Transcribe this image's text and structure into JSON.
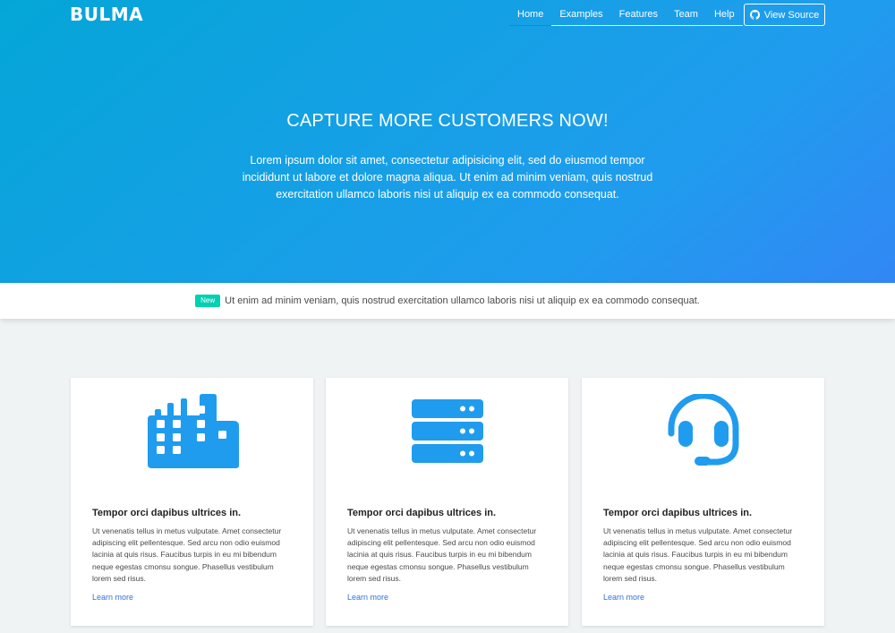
{
  "brand": "BULMA",
  "nav": {
    "items": [
      "Home",
      "Examples",
      "Features",
      "Team",
      "Help"
    ],
    "view_source": "View Source"
  },
  "hero": {
    "title": "CAPTURE MORE CUSTOMERS NOW!",
    "subtitle": "Lorem ipsum dolor sit amet, consectetur adipisicing elit, sed do eiusmod tempor incididunt ut labore et dolore magna aliqua. Ut enim ad minim veniam, quis nostrud exercitation ullamco laboris nisi ut aliquip ex ea commodo consequat."
  },
  "notice": {
    "badge": "New",
    "text": "Ut enim ad minim veniam, quis nostrud exercitation ullamco laboris nisi ut aliquip ex ea commodo consequat."
  },
  "cards": [
    {
      "icon": "building-icon",
      "title": "Tempor orci dapibus ultrices in.",
      "text": "Ut venenatis tellus in metus vulputate. Amet consectetur adipiscing elit pellentesque. Sed arcu non odio euismod lacinia at quis risus. Faucibus turpis in eu mi bibendum neque egestas cmonsu songue. Phasellus vestibulum lorem sed risus.",
      "link": "Learn more"
    },
    {
      "icon": "server-icon",
      "title": "Tempor orci dapibus ultrices in.",
      "text": "Ut venenatis tellus in metus vulputate. Amet consectetur adipiscing elit pellentesque. Sed arcu non odio euismod lacinia at quis risus. Faucibus turpis in eu mi bibendum neque egestas cmonsu songue. Phasellus vestibulum lorem sed risus.",
      "link": "Learn more"
    },
    {
      "icon": "headset-icon",
      "title": "Tempor orci dapibus ultrices in.",
      "text": "Ut venenatis tellus in metus vulputate. Amet consectetur adipiscing elit pellentesque. Sed arcu non odio euismod lacinia at quis risus. Faucibus turpis in eu mi bibendum neque egestas cmonsu songue. Phasellus vestibulum lorem sed risus.",
      "link": "Learn more"
    }
  ],
  "colors": {
    "hero_start": "#04a6d7",
    "hero_end": "#3287f5",
    "icon": "#209cee",
    "badge": "#00d1b2",
    "link": "#3273dc"
  }
}
